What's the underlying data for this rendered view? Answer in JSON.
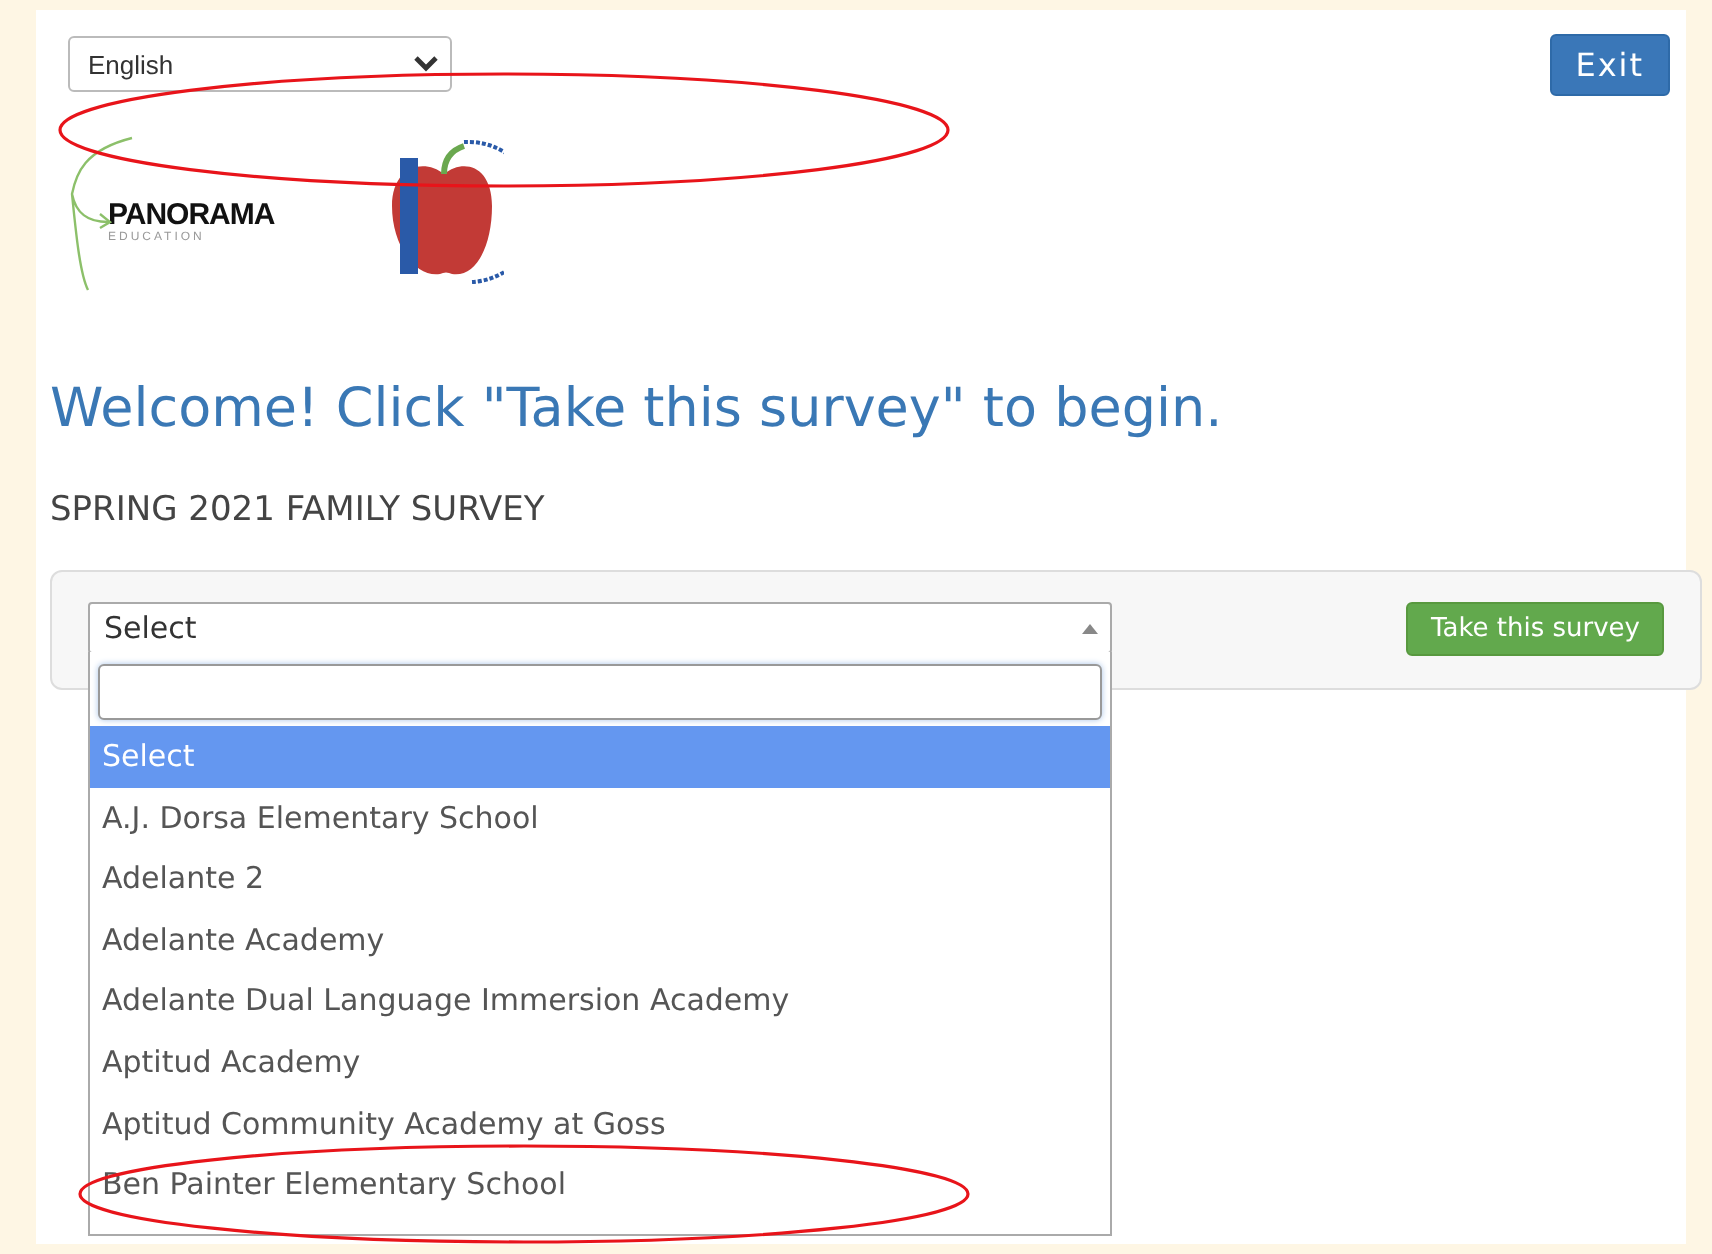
{
  "language_select": {
    "value": "English"
  },
  "exit_button": "Exit",
  "logos": {
    "panorama": {
      "name": "PANORAMA",
      "tagline": "EDUCATION"
    }
  },
  "heading": "Welcome! Click \"Take this survey\" to begin.",
  "survey_title": "SPRING 2021 FAMILY SURVEY",
  "school_select": {
    "value": "Select",
    "expanded": true,
    "options": [
      {
        "label": "Select",
        "selected": true
      },
      {
        "label": "A.J. Dorsa Elementary School",
        "selected": false
      },
      {
        "label": "Adelante 2",
        "selected": false
      },
      {
        "label": "Adelante Academy",
        "selected": false
      },
      {
        "label": "Adelante Dual Language Immersion Academy",
        "selected": false
      },
      {
        "label": "Aptitud Academy",
        "selected": false
      },
      {
        "label": "Aptitud Community Academy at Goss",
        "selected": false
      },
      {
        "label": "Ben Painter Elementary School",
        "selected": false
      }
    ]
  },
  "take_survey_button": "Take this survey"
}
